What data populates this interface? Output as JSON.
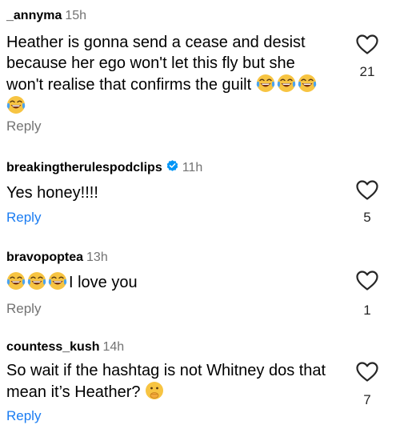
{
  "comments": [
    {
      "username": "_annyma",
      "time": "15h",
      "verified": false,
      "text": "Heather is gonna send a cease and desist because her ego won't let this fly but she won't realise that confirms the guilt",
      "text_emoji_trailing": [
        "face-with-tears-of-joy",
        "face-with-tears-of-joy",
        "face-with-tears-of-joy",
        "face-with-tears-of-joy"
      ],
      "reply_label": "Reply",
      "like_count": "21"
    },
    {
      "username": "breakingtherulespodclips",
      "time": "11h",
      "verified": true,
      "text": "Yes honey!!!!",
      "reply_label": "Reply",
      "like_count": "5"
    },
    {
      "username": "bravopoptea",
      "time": "13h",
      "verified": false,
      "text_emoji_leading": [
        "face-with-tears-of-joy",
        "face-with-tears-of-joy",
        "face-with-tears-of-joy"
      ],
      "text": "I love you",
      "reply_label": "Reply",
      "like_count": "1"
    },
    {
      "username": "countess_kush",
      "time": "14h",
      "verified": false,
      "text": "So wait if the hashtag is not Whitney dos that mean it’s Heather?",
      "text_emoji_trailing": [
        "face-with-open-eyes-and-hand-over-mouth"
      ],
      "reply_label": "Reply",
      "like_count": "7"
    }
  ],
  "colors": {
    "reply_grey": "#737373",
    "reply_blue": "#1a7cf2",
    "verified_badge": "#0095f6",
    "emoji_yellow": "#f7c442"
  }
}
